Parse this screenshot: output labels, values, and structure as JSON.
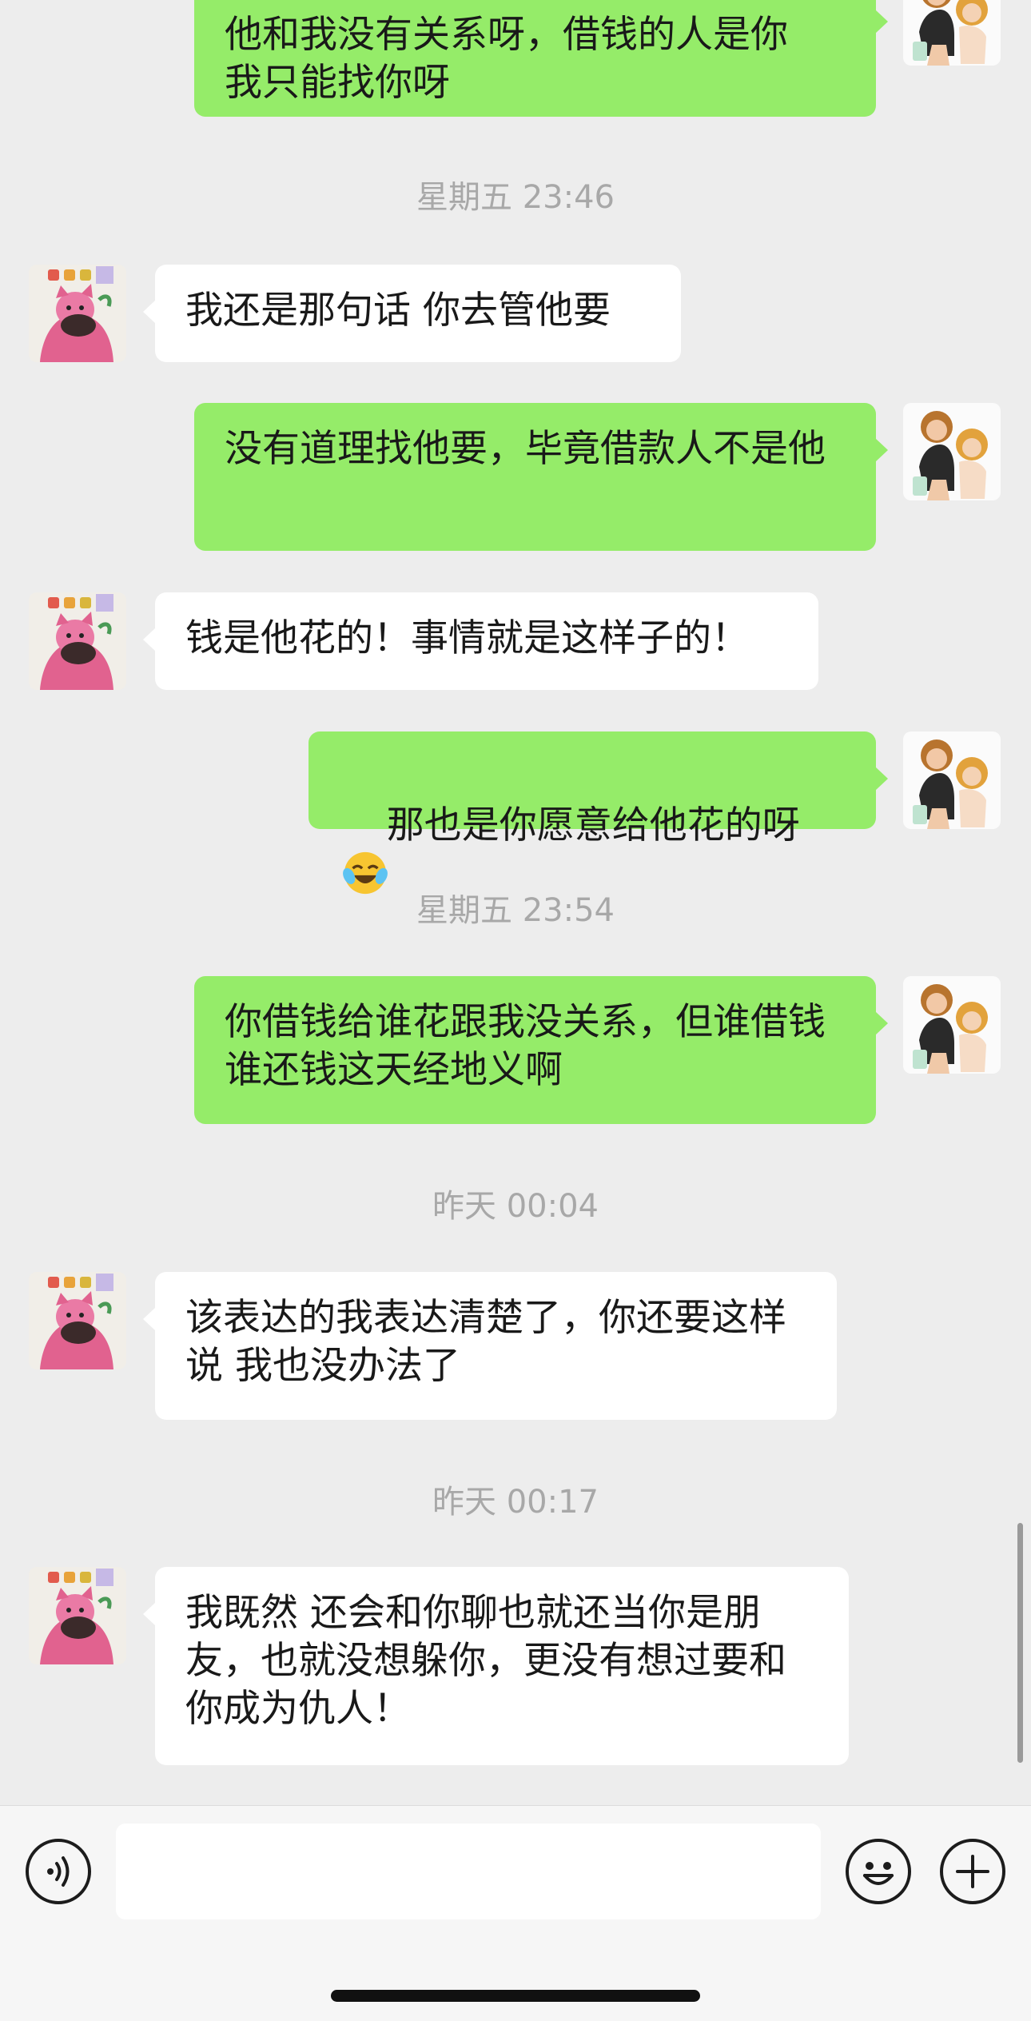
{
  "messages": [
    {
      "side": "out",
      "text": "他和我没有关系呀，借钱的人是你\n我只能找你呀"
    },
    {
      "type": "time",
      "text": "星期五 23:46"
    },
    {
      "side": "in",
      "text": "我还是那句话 你去管他要"
    },
    {
      "side": "out",
      "text": "没有道理找他要，毕竟借款人不是他"
    },
    {
      "side": "in",
      "text": "钱是他花的！事情就是这样子的！"
    },
    {
      "side": "out",
      "text": "那也是你愿意给他花的呀",
      "emoji": "laughing-crying-emoji"
    },
    {
      "type": "time",
      "text": "星期五 23:54"
    },
    {
      "side": "out",
      "text": "你借钱给谁花跟我没关系，但谁借钱谁还钱这天经地义啊"
    },
    {
      "type": "time",
      "text": "昨天 00:04"
    },
    {
      "side": "in",
      "text": "该表达的我表达清楚了，你还要这样说 我也没办法了"
    },
    {
      "type": "time",
      "text": "昨天 00:17"
    },
    {
      "side": "in",
      "text": "我既然 还会和你聊也就还当你是朋友，也就没想躲你，更没有想过要和你成为仇人！"
    }
  ],
  "input_bar": {
    "voice_icon": "voice-icon",
    "text_value": "",
    "emoji_icon": "smiley-icon",
    "plus_icon": "plus-icon"
  },
  "colors": {
    "background": "#ededed",
    "outgoing_bubble": "#95ec69",
    "incoming_bubble": "#ffffff",
    "timestamp": "#a8a8a8"
  }
}
